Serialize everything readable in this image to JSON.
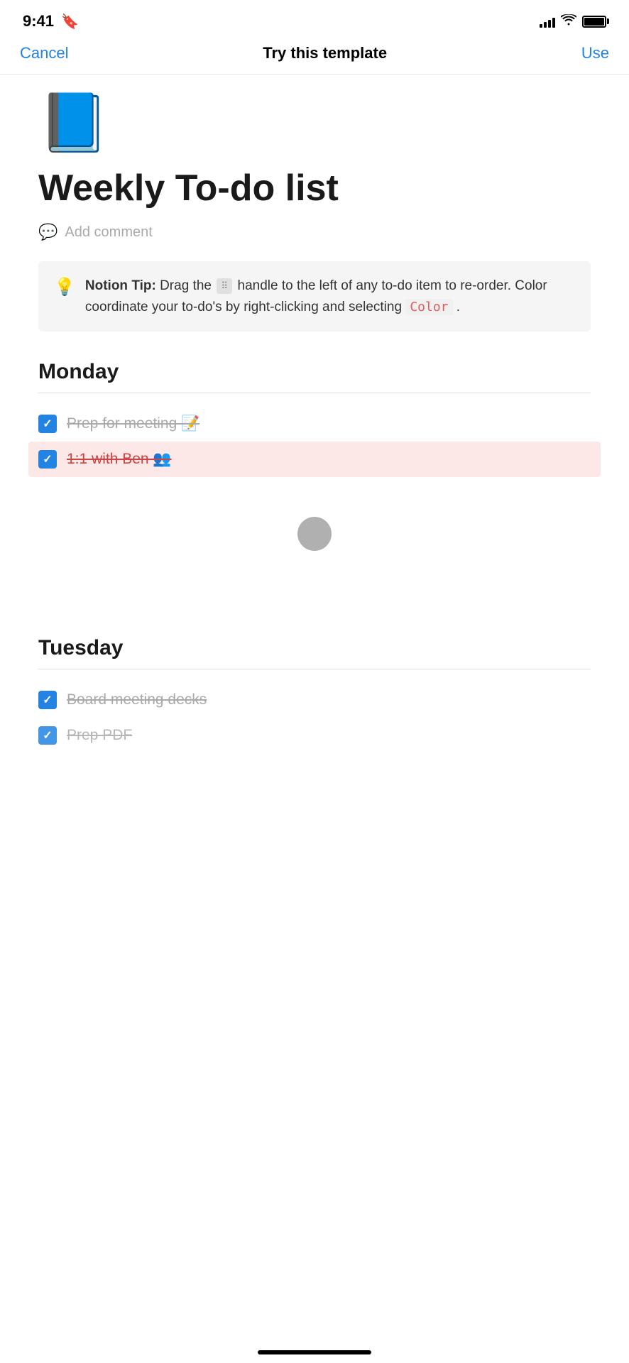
{
  "status_bar": {
    "time": "9:41",
    "signal_label": "signal",
    "wifi_label": "wifi",
    "battery_label": "battery"
  },
  "nav": {
    "cancel_label": "Cancel",
    "title_label": "Try this template",
    "use_label": "Use"
  },
  "page": {
    "book_emoji": "📘",
    "title": "Weekly To-do list",
    "add_comment_placeholder": "Add comment"
  },
  "tip": {
    "icon": "💡",
    "bold_prefix": "Notion Tip:",
    "text": " Drag the  handle to the left of any to-do item to re-order. Color coordinate your to-do's by right-clicking and selecting ",
    "color_word": "Color",
    "suffix": "."
  },
  "days": [
    {
      "name": "Monday",
      "items": [
        {
          "text": "Prep for meeting 📝",
          "checked": true,
          "highlighted": false
        },
        {
          "text": "1:1 with Ben 👥",
          "checked": true,
          "highlighted": true
        }
      ]
    },
    {
      "name": "Tuesday",
      "items": [
        {
          "text": "Board meeting decks",
          "checked": true,
          "highlighted": false
        },
        {
          "text": "Prep PDF",
          "checked": true,
          "highlighted": false
        }
      ]
    }
  ],
  "colors": {
    "accent": "#2383e2",
    "highlight_bg": "#fde8e8",
    "highlight_text": "#cc4444",
    "tip_bg": "#f5f5f5"
  }
}
